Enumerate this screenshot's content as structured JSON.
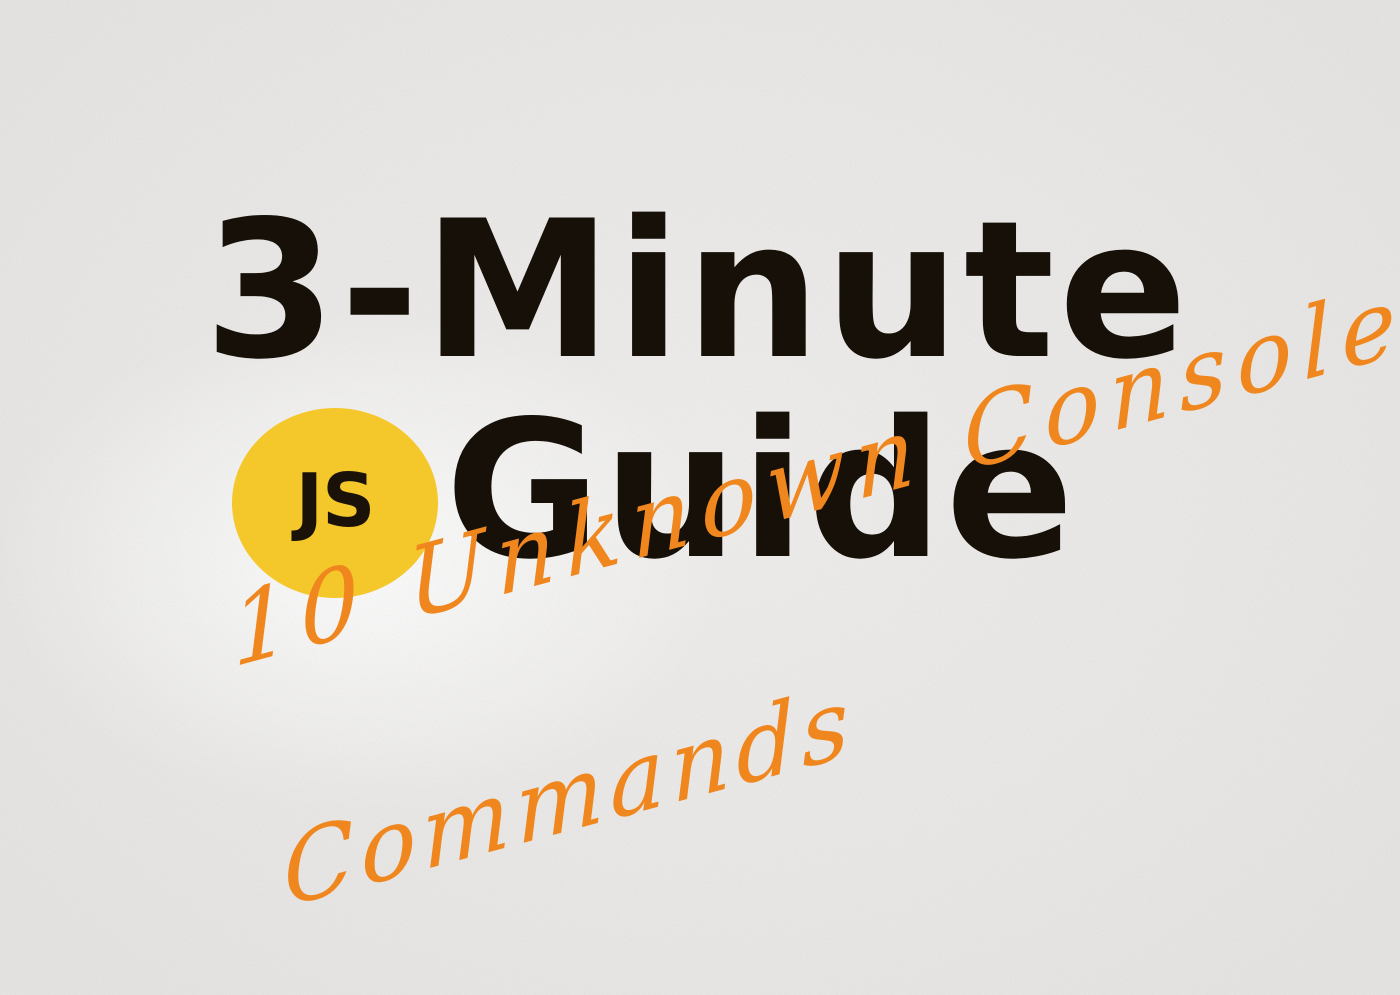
{
  "cover": {
    "title_line_1": "3-Minute",
    "title_line_2": "Guide",
    "logo_text": "JS",
    "subtitle_line_1": "10 Unknown Console",
    "subtitle_line_2": "Commands"
  },
  "colors": {
    "background": "#ecebe9",
    "title": "#161008",
    "logo_circle": "#f4c72a",
    "script_accent": "#f0871e"
  },
  "icons": {
    "logo": "javascript-logo-icon"
  }
}
